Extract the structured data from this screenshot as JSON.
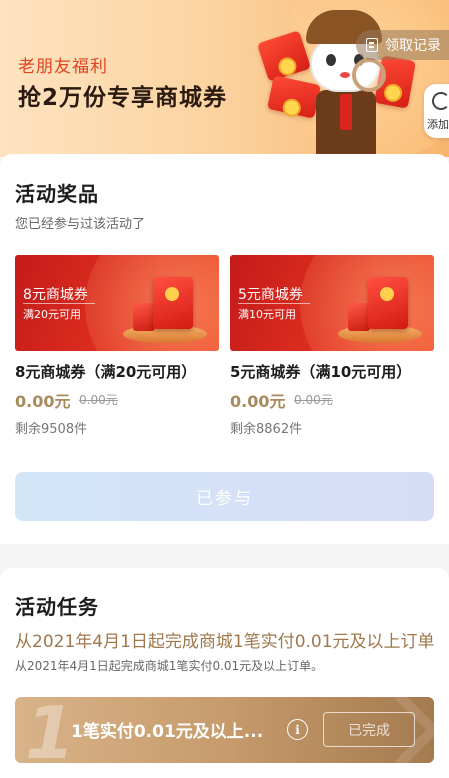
{
  "banner": {
    "subtitle": "老朋友福利",
    "title": "抢2万份专享商城券",
    "record_label": "领取记录",
    "add_label": "添加"
  },
  "prizes_section": {
    "title": "活动奖品",
    "note": "您已经参与过该活动了",
    "items": [
      {
        "coupon_title": "8元商城券",
        "coupon_sub": "满20元可用",
        "name": "8元商城券（满20元可用）",
        "price": "0.00元",
        "original_price": "0.00元",
        "remaining": "剩余9508件"
      },
      {
        "coupon_title": "5元商城券",
        "coupon_sub": "满10元可用",
        "name": "5元商城券（满10元可用）",
        "price": "0.00元",
        "original_price": "0.00元",
        "remaining": "剩余8862件"
      }
    ],
    "joined_button": "已参与"
  },
  "tasks_section": {
    "title": "活动任务",
    "task_title": "从2021年4月1日起完成商城1笔实付0.01元及以上订单",
    "task_desc": "从2021年4月1日起完成商城1笔实付0.01元及以上订单。",
    "step_number": "1",
    "step_text": "1笔实付0.01元及以上...",
    "info_glyph": "i",
    "status_button": "已完成"
  },
  "colors": {
    "accent_gold": "#a0784c",
    "coupon_red": "#d61f16",
    "banner_red_text": "#e0431f"
  }
}
